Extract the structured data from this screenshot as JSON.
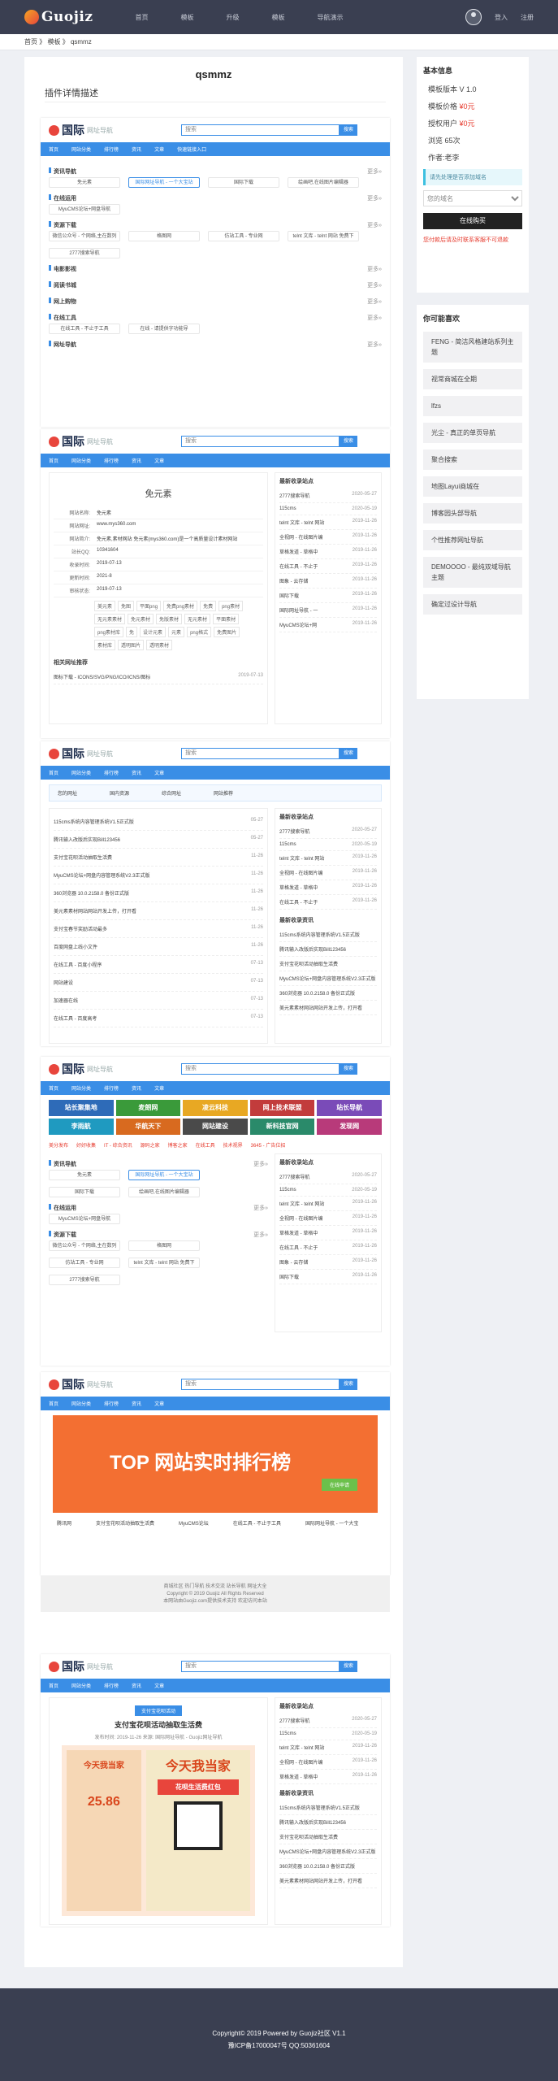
{
  "nav": {
    "logo": "Guojiz",
    "items": [
      "首页",
      "模板",
      "升级",
      "模板",
      "导航演示"
    ],
    "login": "登入",
    "register": "注册"
  },
  "breadcrumb": {
    "home": "首页",
    "sep": "》",
    "c1": "模板",
    "c2": "qsmmz"
  },
  "page": {
    "title": "qsmmz",
    "section": "插件详情描述"
  },
  "info": {
    "title": "基本信息",
    "version": "模板版本 V 1.0",
    "price_label": "模板价格",
    "price": "¥0元",
    "user_label": "授权用户",
    "user_price": "¥0元",
    "views": "浏览 65次",
    "author": "作者:老李",
    "note": "请先处理是否添加域名",
    "select": "您的域名",
    "buy": "在线购买",
    "warning": "您付款后请及时联系客服不可退款"
  },
  "rec": {
    "title": "你可能喜欢",
    "items": [
      "FENG - 简洁风格建站系列主题",
      "视常商城在全期",
      "lfzs",
      "光尘 - 真正的单页导航",
      "聚合搜索",
      "地图Layui商城在",
      "博客园头部导航",
      "个性推荐网址导航",
      "DEMOOOO - 最纯双域导航主题",
      "确定过设计导航"
    ]
  },
  "demo": {
    "logo": "国际",
    "logo_sub": "网址导航",
    "search_ph": "搜索",
    "search_btn": "搜索",
    "bar": [
      "首页",
      "网站分类",
      "排行榜",
      "资讯",
      "文章",
      "快速链接入口"
    ],
    "cats": [
      {
        "name": "资讯导航",
        "more": "更多»",
        "cells": [
          "免元素",
          "国际网址导航 - 一个大宝站",
          "国际下载",
          "绘画吧,在线图片编辑器"
        ]
      },
      {
        "name": "在线运用",
        "more": "更多»",
        "cells": [
          "MyuCMS论坛+网盘导航"
        ]
      },
      {
        "name": "资源下载",
        "more": "更多»",
        "cells": [
          "微信公众号 - 个网络,主在数列",
          "格图网",
          "仿站工具 - 专业网",
          "telnt 文库 - telnt 网站 免费下",
          "2777搜索导航"
        ]
      },
      {
        "name": "电影影视",
        "more": "更多»",
        "cells": []
      },
      {
        "name": "阅读书城",
        "more": "更多»",
        "cells": []
      },
      {
        "name": "网上购物",
        "more": "更多»",
        "cells": []
      },
      {
        "name": "在线工具",
        "more": "更多»",
        "cells": [
          "在线工具 - 不止于工具",
          "在线 - 请提供字功能导"
        ]
      },
      {
        "name": "网址导航",
        "more": "更多»",
        "cells": []
      }
    ]
  },
  "detail": {
    "title": "免元素",
    "fields": [
      [
        "网站名称:",
        "免元素"
      ],
      [
        "网站网址:",
        "www.mys360.com"
      ],
      [
        "网站简介:",
        "免元素,素材网站 免元素(mys360.com)是一个高质量设计素材网站"
      ],
      [
        "站长QQ:",
        "10341604"
      ],
      [
        "收录时间:",
        "2019-07-13"
      ],
      [
        "更新时间:",
        "2021-8"
      ],
      [
        "审核状态:",
        "2019-07-13"
      ]
    ],
    "tags": [
      "美元素",
      "免图",
      "平面png",
      "免费png素材",
      "免费",
      "png素材",
      "无元素素材",
      "免元素材",
      "免版素材",
      "无元素材",
      "平面素材",
      "png素材库",
      "免",
      "设计元素",
      "元素",
      "png格式",
      "免费图片",
      "素材库",
      "透明图片",
      "透明素材"
    ],
    "related": "相关网址推荐",
    "related_item": "图标下载 - ICONS/SVG/PNG/ICO/ICNS/图标",
    "related_date": "2019-07-13"
  },
  "latest": {
    "title": "最新收录站点",
    "items": [
      [
        "2777搜索导航",
        "2020-05-27"
      ],
      [
        "115cms",
        "2020-05-19"
      ],
      [
        "telnt 文库 - telnt 网站",
        "2019-11-26"
      ],
      [
        "全视网 - 在线图片编",
        "2019-11-26"
      ],
      [
        "草格发道 - 草格中",
        "2019-11-26"
      ],
      [
        "在线工具 - 不止于",
        "2019-11-26"
      ],
      [
        "图象 - 云存储",
        "2019-11-26"
      ],
      [
        "国际下载",
        "2019-11-26"
      ],
      [
        "国际网址导航 - 一",
        "2019-11-26"
      ],
      [
        "MyuCMS论坛+网",
        "2019-11-26"
      ]
    ]
  },
  "news": {
    "title": "最新收录资讯",
    "items": [
      [
        "115cms系统内容管理系统V1.5正式版",
        "05-27"
      ],
      [
        "腾讯输入改版后实现Bill123456",
        "05-27"
      ],
      [
        "支付宝花呗活动抽取生活费",
        "11-26"
      ],
      [
        "MyuCMS论坛+网盘内容管理系统V2.3正式版",
        "11-26"
      ],
      [
        "360浏览器 10.0.2158.0 备份正式版",
        "11-26"
      ],
      [
        "美元素素材网站网站开发上传，打开看",
        "11-26"
      ],
      [
        "支付宝春节奖励活动最多",
        "11-26"
      ],
      [
        "百度网盘上线小文件",
        "11-26"
      ],
      [
        "在线工具 - 百度小程序",
        "07-13"
      ],
      [
        "网站建设",
        "07-13"
      ],
      [
        "加速器在线",
        "07-13"
      ],
      [
        "在线工具 - 百度高考",
        "07-13"
      ]
    ]
  },
  "subcats": [
    "您的网址",
    "国内资源",
    "综合网址",
    "网站推荐"
  ],
  "bars": [
    "站长聚集地",
    "麦朗网",
    "凌云科技",
    "网上技术联盟",
    "站长导航",
    "李雨航",
    "华航天下",
    "网站建设",
    "新科技官网",
    "发现网"
  ],
  "links": [
    "美分发布",
    "好好收集",
    "IT - 综合资讯",
    "源码之家",
    "博客之家",
    "在线工具",
    "技术视界",
    "3645 - 广告位招"
  ],
  "rank": {
    "text": "TOP 网站实时排行榜",
    "btn": "在线申请"
  },
  "rank_items": [
    "腾讯网",
    "支付宝花呗活动抽取生活费",
    "MyuCMS论坛",
    "在线工具 - 不止于工具",
    "国际网址导航 - 一个大宝"
  ],
  "sub_footer": [
    "商城社区 热门导航 技术交流 站长导航 网址大全",
    "Copyright © 2019 Guojiz All Rights Reserved",
    "本网站由Guojiz.com提供技术支持 欢迎访问本站"
  ],
  "article": {
    "tag": "支付宝花呗活动",
    "title": "支付宝花呗活动抽取生活费",
    "meta": "发布时间: 2019-11-26 来源: 国际网址导航 - Guojiz网址导航",
    "p1": "今天我当家",
    "p2": "花呗生活费红包",
    "amt": "25.86"
  },
  "footer": {
    "line1": "Copyright© 2019 Powered by Guojiz社区 V1.1",
    "line2": "豫ICP备17000047号 QQ:50361604"
  }
}
